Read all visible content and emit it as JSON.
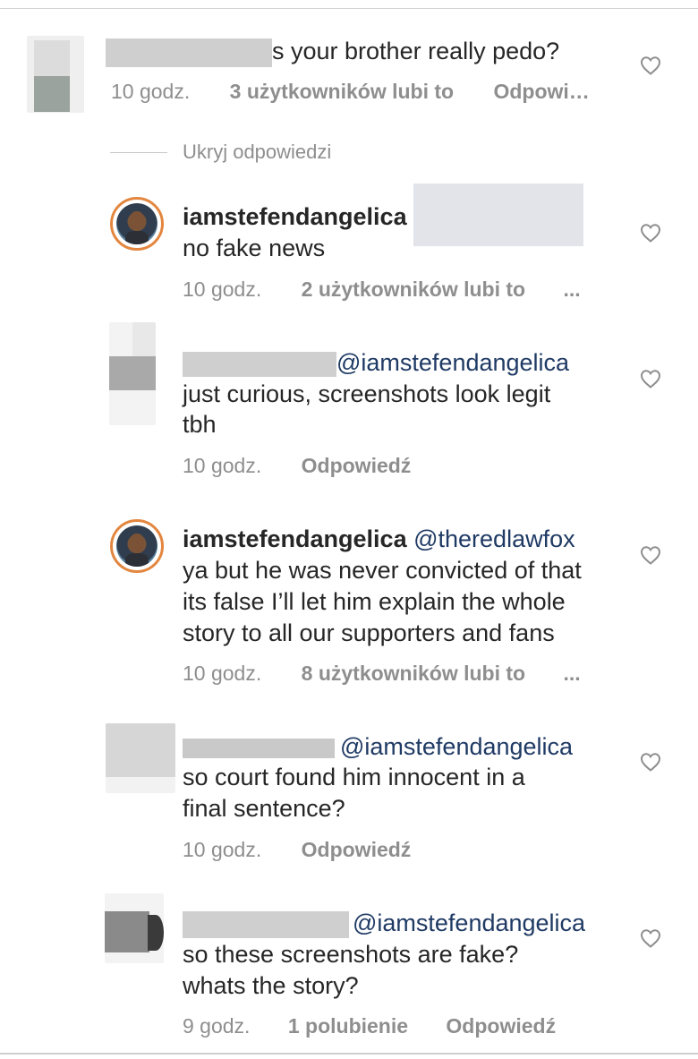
{
  "comments": [
    {
      "text": "s your brother really pedo?",
      "time": "10 godz.",
      "likes": "3 użytkowników lubi to",
      "reply": "Odpowi…"
    },
    {
      "username": "iamstefendangelica",
      "text": "no fake news",
      "time": "10 godz.",
      "likes": "2 użytkowników lubi to",
      "more": "..."
    },
    {
      "mention": "@iamstefendangelica",
      "text_lines": [
        "just curious, screenshots look legit",
        "tbh"
      ],
      "time": "10 godz.",
      "reply": "Odpowiedź"
    },
    {
      "username": "iamstefendangelica",
      "mention": "@theredlawfox",
      "text_lines": [
        "ya but he was never convicted of that",
        "its false I’ll let him explain the whole",
        "story to all our supporters and fans"
      ],
      "time": "10 godz.",
      "likes": "8 użytkowników lubi to",
      "more": "..."
    },
    {
      "mention": "@iamstefendangelica",
      "text_lines": [
        "so court found him innocent in a",
        "final sentence?"
      ],
      "time": "10 godz.",
      "reply": "Odpowiedź"
    },
    {
      "mention": "@iamstefendangelica",
      "text_lines": [
        "so these screenshots are fake?",
        "whats the story?"
      ],
      "time": "9 godz.",
      "likes": "1 polubienie",
      "reply": "Odpowiedź"
    }
  ],
  "hide_replies": "Ukryj odpowiedzi",
  "icons": {
    "like": "heart-outline-icon"
  },
  "colors": {
    "mention": "#1f3a64",
    "meta": "#8e8e8e",
    "ring": "#e3863f"
  }
}
